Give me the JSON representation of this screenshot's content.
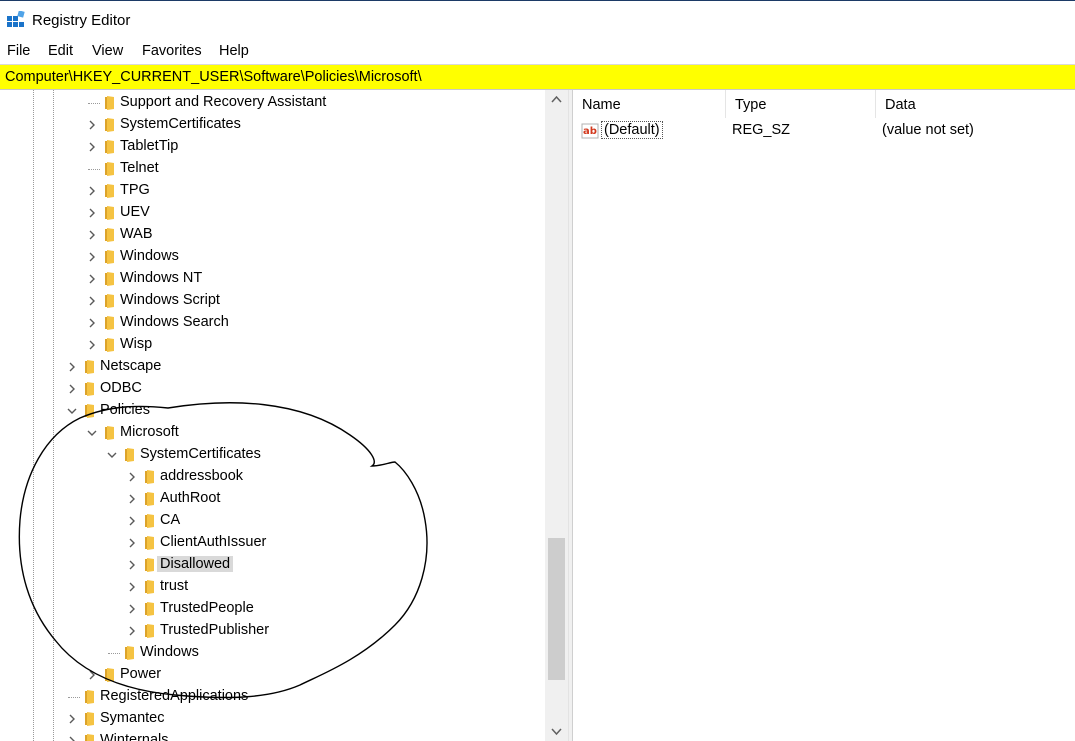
{
  "window": {
    "title": "Registry Editor",
    "icon": "registry-editor-icon"
  },
  "menu": [
    "File",
    "Edit",
    "View",
    "Favorites",
    "Help"
  ],
  "address": {
    "path": "Computer\\HKEY_CURRENT_USER\\Software\\Policies\\Microsoft\\",
    "highlight_color": "#ffff00"
  },
  "tree": [
    {
      "label": "Support and Recovery Assistant",
      "depth": 2,
      "expander": "none"
    },
    {
      "label": "SystemCertificates",
      "depth": 2,
      "expander": "collapsed"
    },
    {
      "label": "TabletTip",
      "depth": 2,
      "expander": "collapsed"
    },
    {
      "label": "Telnet",
      "depth": 2,
      "expander": "none"
    },
    {
      "label": "TPG",
      "depth": 2,
      "expander": "collapsed"
    },
    {
      "label": "UEV",
      "depth": 2,
      "expander": "collapsed"
    },
    {
      "label": "WAB",
      "depth": 2,
      "expander": "collapsed"
    },
    {
      "label": "Windows",
      "depth": 2,
      "expander": "collapsed"
    },
    {
      "label": "Windows NT",
      "depth": 2,
      "expander": "collapsed"
    },
    {
      "label": "Windows Script",
      "depth": 2,
      "expander": "collapsed"
    },
    {
      "label": "Windows Search",
      "depth": 2,
      "expander": "collapsed"
    },
    {
      "label": "Wisp",
      "depth": 2,
      "expander": "collapsed"
    },
    {
      "label": "Netscape",
      "depth": 1,
      "expander": "collapsed"
    },
    {
      "label": "ODBC",
      "depth": 1,
      "expander": "collapsed"
    },
    {
      "label": "Policies",
      "depth": 1,
      "expander": "expanded"
    },
    {
      "label": "Microsoft",
      "depth": 2,
      "expander": "expanded"
    },
    {
      "label": "SystemCertificates",
      "depth": 3,
      "expander": "expanded"
    },
    {
      "label": "addressbook",
      "depth": 4,
      "expander": "collapsed"
    },
    {
      "label": "AuthRoot",
      "depth": 4,
      "expander": "collapsed"
    },
    {
      "label": "CA",
      "depth": 4,
      "expander": "collapsed"
    },
    {
      "label": "ClientAuthIssuer",
      "depth": 4,
      "expander": "collapsed"
    },
    {
      "label": "Disallowed",
      "depth": 4,
      "expander": "collapsed",
      "selected": true
    },
    {
      "label": "trust",
      "depth": 4,
      "expander": "collapsed"
    },
    {
      "label": "TrustedPeople",
      "depth": 4,
      "expander": "collapsed"
    },
    {
      "label": "TrustedPublisher",
      "depth": 4,
      "expander": "collapsed"
    },
    {
      "label": "Windows",
      "depth": 3,
      "expander": "none"
    },
    {
      "label": "Power",
      "depth": 2,
      "expander": "collapsed"
    },
    {
      "label": "RegisteredApplications",
      "depth": 1,
      "expander": "none"
    },
    {
      "label": "Symantec",
      "depth": 1,
      "expander": "collapsed"
    },
    {
      "label": "Winternals",
      "depth": 1,
      "expander": "collapsed"
    }
  ],
  "columns": [
    "Name",
    "Type",
    "Data"
  ],
  "values": [
    {
      "name": "(Default)",
      "type": "REG_SZ",
      "data": "(value not set)",
      "icon": "string-value-icon"
    }
  ],
  "colors": {
    "folder": "#f5c342",
    "folder_dark": "#dca32a",
    "selection": "#d9d9d9",
    "annotation": "#000000"
  }
}
